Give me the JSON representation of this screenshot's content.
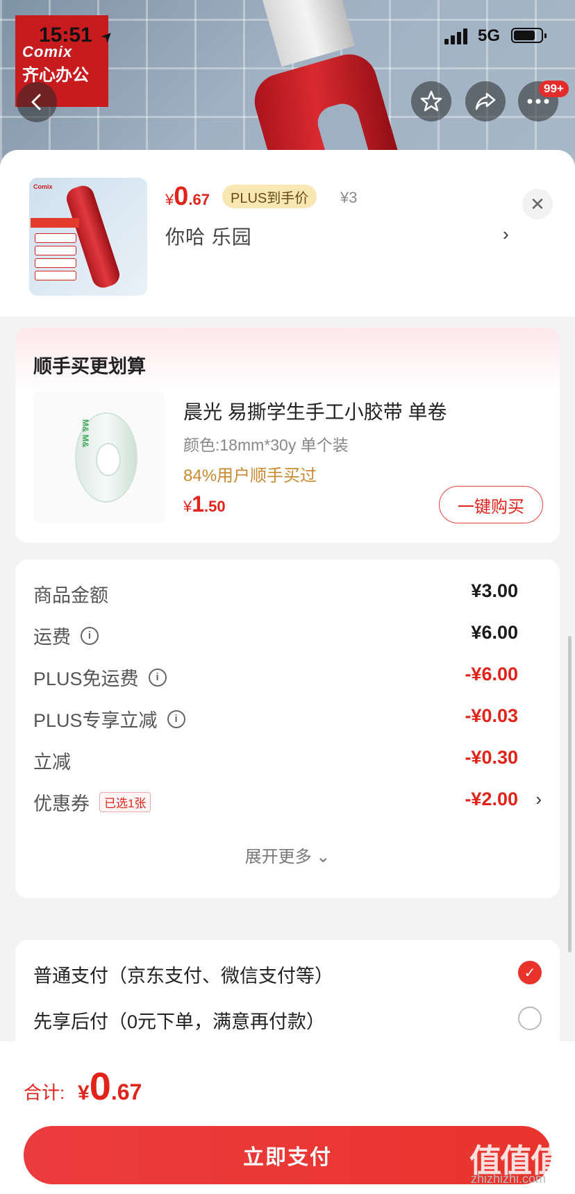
{
  "status_bar": {
    "time": "15:51",
    "network": "5G"
  },
  "brand": {
    "logo_line1": "Comix",
    "logo_line2": "齐心办公"
  },
  "header": {
    "badge": "99+"
  },
  "product": {
    "price_currency": "¥",
    "price_int": "0",
    "price_dec": ".67",
    "plus_tag": "PLUS到手价",
    "original_price": "¥3",
    "variant": "你哈  乐园"
  },
  "upsell": {
    "title": "顺手买更划算",
    "name": "晨光 易撕学生手工小胶带 单卷",
    "spec": "颜色:18mm*30y 单个装",
    "stat": "84%用户顺手买过",
    "price_currency": "¥",
    "price_int": "1",
    "price_dec": ".50",
    "buy_label": "一键购买"
  },
  "summary": {
    "rows": [
      {
        "label": "商品金额",
        "value": "¥3.00"
      },
      {
        "label": "运费",
        "value": "¥6.00"
      },
      {
        "label": "PLUS免运费",
        "value": "-¥6.00"
      },
      {
        "label": "PLUS专享立减",
        "value": "-¥0.03"
      },
      {
        "label": "立减",
        "value": "-¥0.30"
      },
      {
        "label": "优惠券",
        "value": "-¥2.00",
        "tag": "已选1张"
      }
    ],
    "expand_label": "展开更多 ⌄"
  },
  "payment": {
    "options": [
      {
        "label": "普通支付（京东支付、微信支付等）",
        "selected": true
      },
      {
        "label": "先享后付（0元下单，满意再付款）",
        "selected": false
      }
    ]
  },
  "bottom": {
    "total_label": "合计:",
    "total_currency": "¥",
    "total_int": "0",
    "total_dec": ".67",
    "pay_button": "立即支付",
    "watermark": "值值值",
    "watermark_url": "zhizhizhi.com"
  },
  "icons": {
    "back": "back-arrow-icon",
    "favorite": "star-icon",
    "share": "share-icon",
    "more": "more-icon",
    "close": "close-icon",
    "info": "info-icon",
    "chevron": "chevron-right-icon",
    "check": "check-icon"
  },
  "colors": {
    "accent": "#e2231a",
    "plus_tag_bg": "#f8e6b3",
    "brand_red": "#c81b1e"
  }
}
